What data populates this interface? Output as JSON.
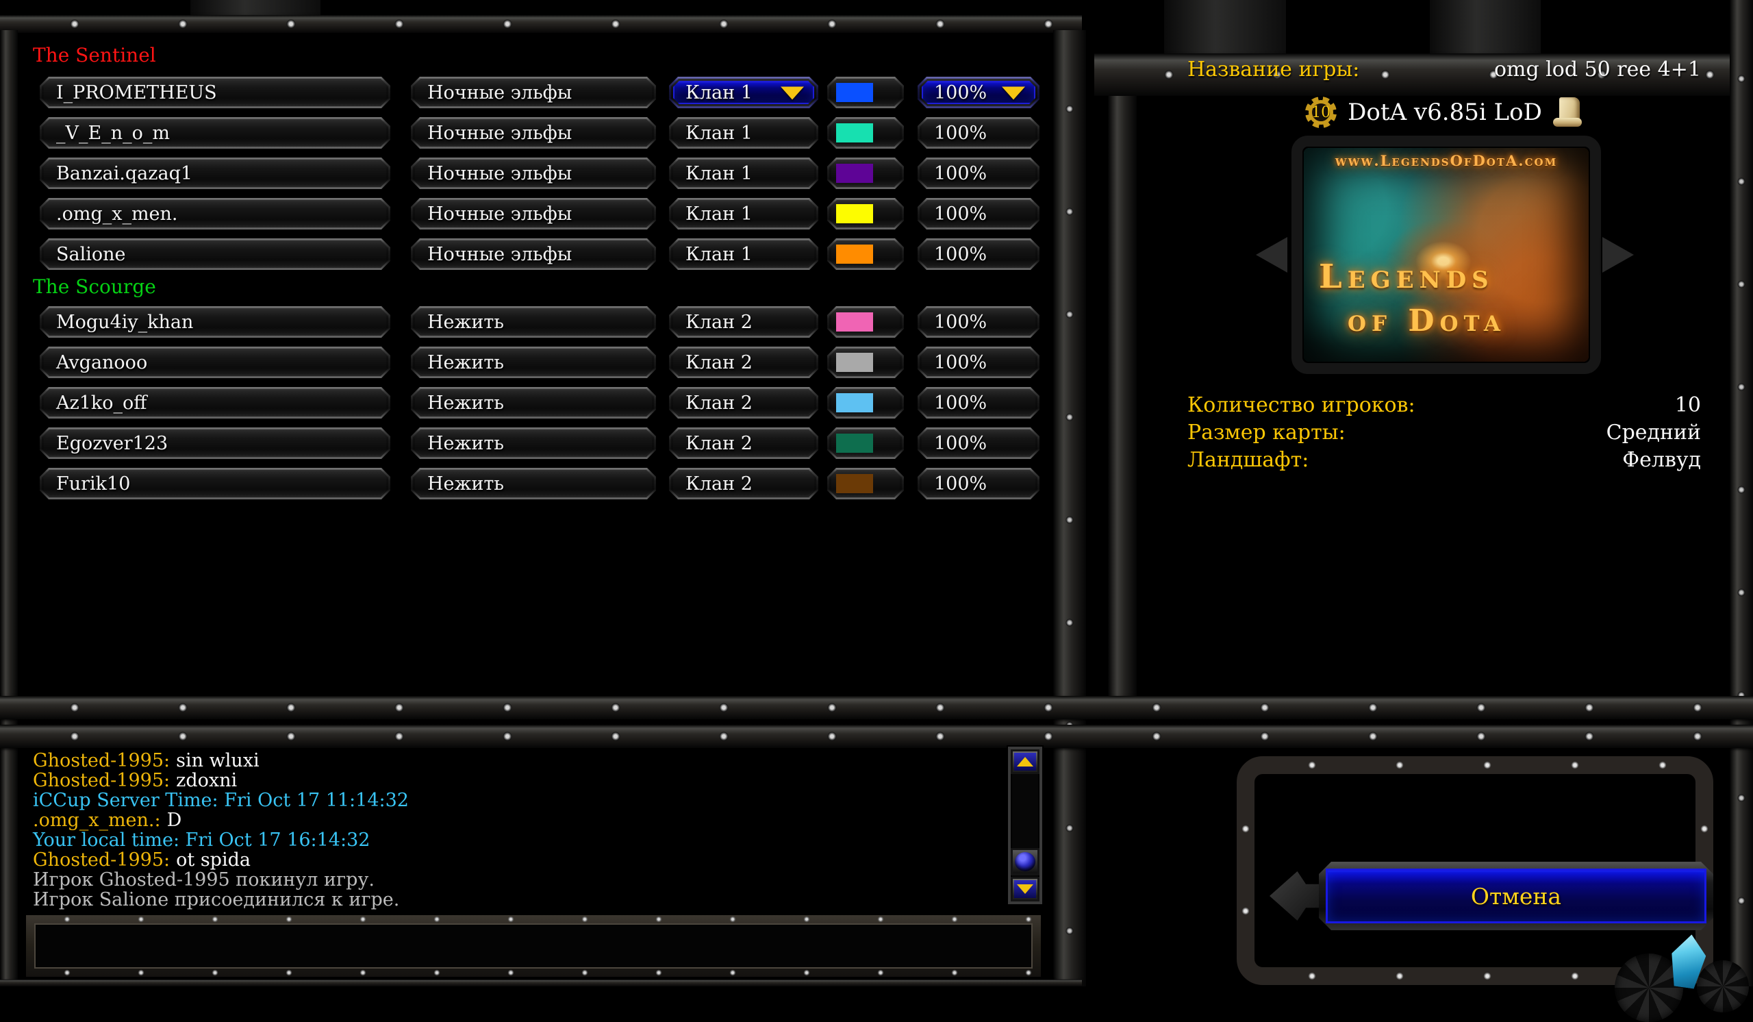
{
  "colors": {
    "team1": "#ff1414",
    "team2": "#06d215",
    "label_gold": "#fcc705",
    "chat_gold": "#eeb60a",
    "chat_cyan": "#39c4f4",
    "chat_gray": "#bcbcbc",
    "text_white": "#fafafa",
    "cancel_blue": "#05054c"
  },
  "icons": {
    "map_badge": "gear-icon",
    "map_script": "scroll-icon",
    "dropdowns": "gold-down-arrow",
    "scrollbar": [
      "triangle-up",
      "blue-orb-thumb",
      "triangle-down"
    ]
  },
  "lobby": {
    "teams": [
      {
        "name": "The Sentinel",
        "color": "#ff1414",
        "players": [
          {
            "name": "I_PROMETHEUS",
            "race": "Ночные эльфы",
            "clan": "Клан 1",
            "color": "#0a50ff",
            "handicap": "100%"
          },
          {
            "name": "_V_E_n_o_m",
            "race": "Ночные эльфы",
            "clan": "Клан 1",
            "color": "#17e0b0",
            "handicap": "100%"
          },
          {
            "name": "Banzai.qazaq1",
            "race": "Ночные эльфы",
            "clan": "Клан 1",
            "color": "#5e0496",
            "handicap": "100%"
          },
          {
            "name": ".omg_x_men.",
            "race": "Ночные эльфы",
            "clan": "Клан 1",
            "color": "#fdfc00",
            "handicap": "100%"
          },
          {
            "name": "Salione",
            "race": "Ночные эльфы",
            "clan": "Клан 1",
            "color": "#ff8c00",
            "handicap": "100%"
          }
        ]
      },
      {
        "name": "The Scourge",
        "color": "#06d215",
        "players": [
          {
            "name": "Mogu4iy_khan",
            "race": "Нежить",
            "clan": "Клан 2",
            "color": "#f064b4",
            "handicap": "100%"
          },
          {
            "name": "Avganooo",
            "race": "Нежить",
            "clan": "Клан 2",
            "color": "#a9a9a9",
            "handicap": "100%"
          },
          {
            "name": "Az1ko_off",
            "race": "Нежить",
            "clan": "Клан 2",
            "color": "#5ec1f2",
            "handicap": "100%"
          },
          {
            "name": "Egozver123",
            "race": "Нежить",
            "clan": "Клан 2",
            "color": "#0e6e4e",
            "handicap": "100%"
          },
          {
            "name": "Furik10",
            "race": "Нежить",
            "clan": "Клан 2",
            "color": "#6b3a06",
            "handicap": "100%"
          }
        ]
      }
    ]
  },
  "game_info": {
    "name_label": "Название игры:",
    "name_value": "omg lod 50 ree 4+1",
    "map_badge": "10",
    "map_title": "DotA v6.85i LoD",
    "map_preview": {
      "site": "www.LegendsOfDotA.com",
      "title_line1": "Legends",
      "title_line2": "of Dota"
    },
    "players_label": "Количество игроков:",
    "players_value": "10",
    "size_label": "Размер карты:",
    "size_value": "Средний",
    "terrain_label": "Ландшафт:",
    "terrain_value": "Фелвуд"
  },
  "chat": {
    "messages": [
      {
        "type": "player",
        "name": "Ghosted-1995:",
        "text": "sin wluxi"
      },
      {
        "type": "player",
        "name": "Ghosted-1995:",
        "text": "zdoxni"
      },
      {
        "type": "info",
        "text": "iCCup Server Time: Fri Oct 17 11:14:32"
      },
      {
        "type": "player",
        "name": ".omg_x_men.:",
        "text": "D"
      },
      {
        "type": "info",
        "text": "Your local time: Fri Oct 17 16:14:32"
      },
      {
        "type": "player",
        "name": "Ghosted-1995:",
        "text": "ot spida"
      },
      {
        "type": "system",
        "text": "Игрок Ghosted-1995 покинул игру."
      },
      {
        "type": "system",
        "text": "Игрок Salione присоединился к игре."
      }
    ],
    "input_value": ""
  },
  "footer": {
    "cancel_label": "Отмена"
  }
}
